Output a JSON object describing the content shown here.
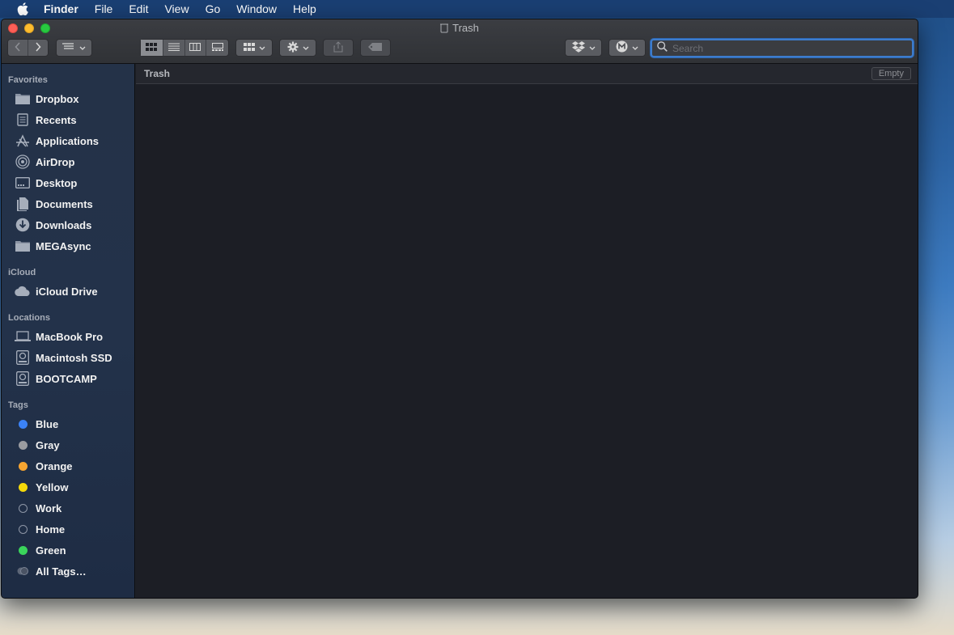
{
  "menubar": {
    "app_name": "Finder",
    "items": [
      "File",
      "Edit",
      "View",
      "Go",
      "Window",
      "Help"
    ]
  },
  "window": {
    "title": "Trash"
  },
  "search": {
    "placeholder": "Search"
  },
  "sidebar": {
    "sections": {
      "favorites": "Favorites",
      "icloud": "iCloud",
      "locations": "Locations",
      "tags": "Tags"
    },
    "favorites": [
      {
        "label": "Dropbox",
        "icon": "folder-icon"
      },
      {
        "label": "Recents",
        "icon": "recents-icon"
      },
      {
        "label": "Applications",
        "icon": "applications-icon"
      },
      {
        "label": "AirDrop",
        "icon": "airdrop-icon"
      },
      {
        "label": "Desktop",
        "icon": "desktop-icon"
      },
      {
        "label": "Documents",
        "icon": "documents-icon"
      },
      {
        "label": "Downloads",
        "icon": "downloads-icon"
      },
      {
        "label": "MEGAsync",
        "icon": "folder-icon"
      }
    ],
    "icloud": [
      {
        "label": "iCloud Drive",
        "icon": "cloud-icon"
      }
    ],
    "locations": [
      {
        "label": "MacBook Pro",
        "icon": "laptop-icon"
      },
      {
        "label": "Macintosh SSD",
        "icon": "disk-icon"
      },
      {
        "label": "BOOTCAMP",
        "icon": "disk-icon"
      }
    ],
    "tags": [
      {
        "label": "Blue",
        "color": "#3b82f6"
      },
      {
        "label": "Gray",
        "color": "#9a9ca1"
      },
      {
        "label": "Orange",
        "color": "#f7a531"
      },
      {
        "label": "Yellow",
        "color": "#f5d90a"
      },
      {
        "label": "Work",
        "color": "outline"
      },
      {
        "label": "Home",
        "color": "outline"
      },
      {
        "label": "Green",
        "color": "#3ad45b"
      },
      {
        "label": "All Tags…",
        "color": "all"
      }
    ]
  },
  "content": {
    "path_label": "Trash",
    "empty_button": "Empty"
  }
}
